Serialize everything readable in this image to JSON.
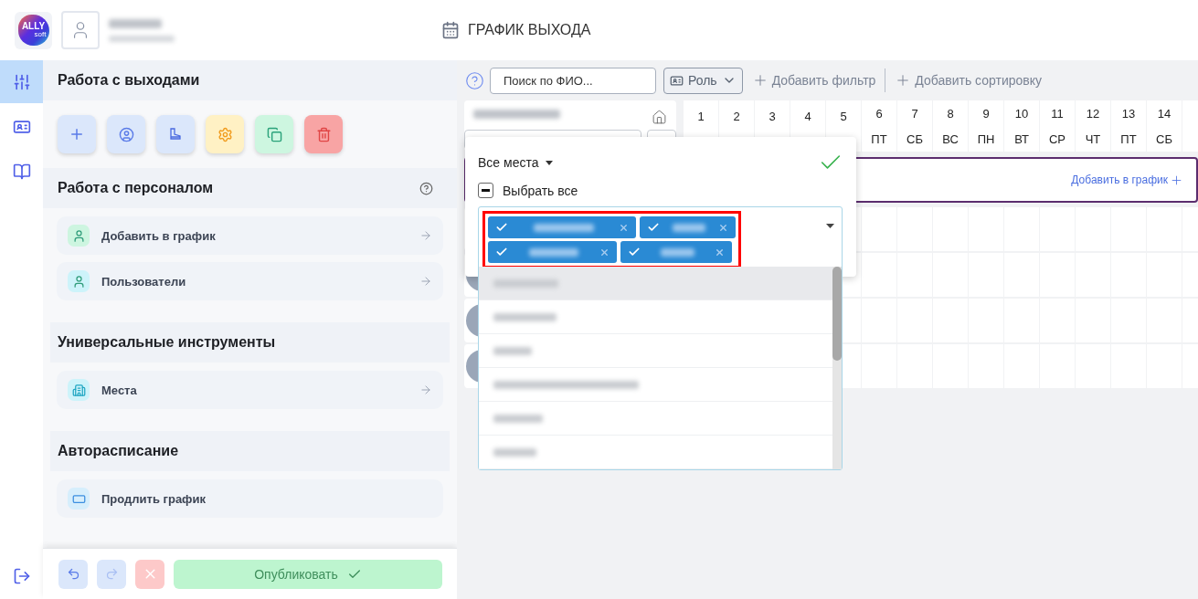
{
  "header": {
    "logo": {
      "text": "ALLY",
      "subtext": "soft"
    },
    "title": "ГРАФИК ВЫХОДА"
  },
  "rail": [
    {
      "kind": "sliders",
      "selected": true
    },
    {
      "kind": "card",
      "selected": false
    },
    {
      "kind": "book",
      "selected": false
    }
  ],
  "panel": {
    "title": "Работа с выходами",
    "tools": [
      {
        "kind": "add"
      },
      {
        "kind": "person"
      },
      {
        "kind": "boot"
      },
      {
        "kind": "gear"
      },
      {
        "kind": "copy"
      },
      {
        "kind": "delete"
      }
    ],
    "groups": [
      {
        "title": "Работа с персоналом",
        "help": true,
        "items": [
          {
            "label": "Добавить в график",
            "kind": "person",
            "color": "#cdf5e0",
            "arrow": true
          },
          {
            "label": "Пользователи",
            "kind": "person",
            "color": "#cdf3fa",
            "arrow": true
          }
        ]
      },
      {
        "title": "Универсальные инструменты",
        "help": false,
        "items": [
          {
            "label": "Места",
            "kind": "building",
            "color": "#cdf3fa",
            "arrow": true
          }
        ]
      },
      {
        "title": "Авторасписание",
        "help": false,
        "items": [
          {
            "label": "Продлить график",
            "kind": "extend",
            "color": "#d6eefc",
            "arrow": false
          }
        ]
      }
    ]
  },
  "actions": {
    "publish": "Опубликовать"
  },
  "toolbar": {
    "search": {
      "placeholder": "Поиск по ФИО..."
    },
    "role": "Роль",
    "add_filter": "Добавить фильтр",
    "add_sort": "Добавить сортировку"
  },
  "days": [
    {
      "num": "1"
    },
    {
      "num": "2"
    },
    {
      "num": "3"
    },
    {
      "num": "4"
    },
    {
      "num": "5"
    },
    {
      "num": "6",
      "dow": "ПТ"
    },
    {
      "num": "7",
      "dow": "СБ"
    },
    {
      "num": "8",
      "dow": "ВС"
    },
    {
      "num": "9",
      "dow": "ПН"
    },
    {
      "num": "10",
      "dow": "ВТ"
    },
    {
      "num": "11",
      "dow": "СР"
    },
    {
      "num": "12",
      "dow": "ЧТ"
    },
    {
      "num": "13",
      "dow": "ПТ"
    },
    {
      "num": "14",
      "dow": "СБ"
    }
  ],
  "add_row": {
    "label": "Добавить в график"
  },
  "employees": [
    {
      "kind": "redacted"
    },
    {
      "kind": "redacted"
    },
    {
      "kind": "redacted"
    },
    {
      "kind": "redacted"
    }
  ],
  "popup": {
    "scope": "Все места",
    "select_all": "Выбрать все",
    "select_all_partial": true,
    "chips": [
      {
        "kind": "redacted"
      },
      {
        "kind": "redacted"
      },
      {
        "kind": "redacted"
      },
      {
        "kind": "redacted"
      }
    ],
    "annotation": {
      "kind": "frame",
      "color": "#ff0000"
    },
    "options": [
      {
        "kind": "redacted",
        "highlighted": true
      },
      {
        "kind": "redacted",
        "highlighted": false
      },
      {
        "kind": "redacted",
        "highlighted": false
      },
      {
        "kind": "redacted",
        "highlighted": false
      },
      {
        "kind": "redacted",
        "highlighted": false
      },
      {
        "kind": "redacted",
        "highlighted": false
      }
    ]
  }
}
